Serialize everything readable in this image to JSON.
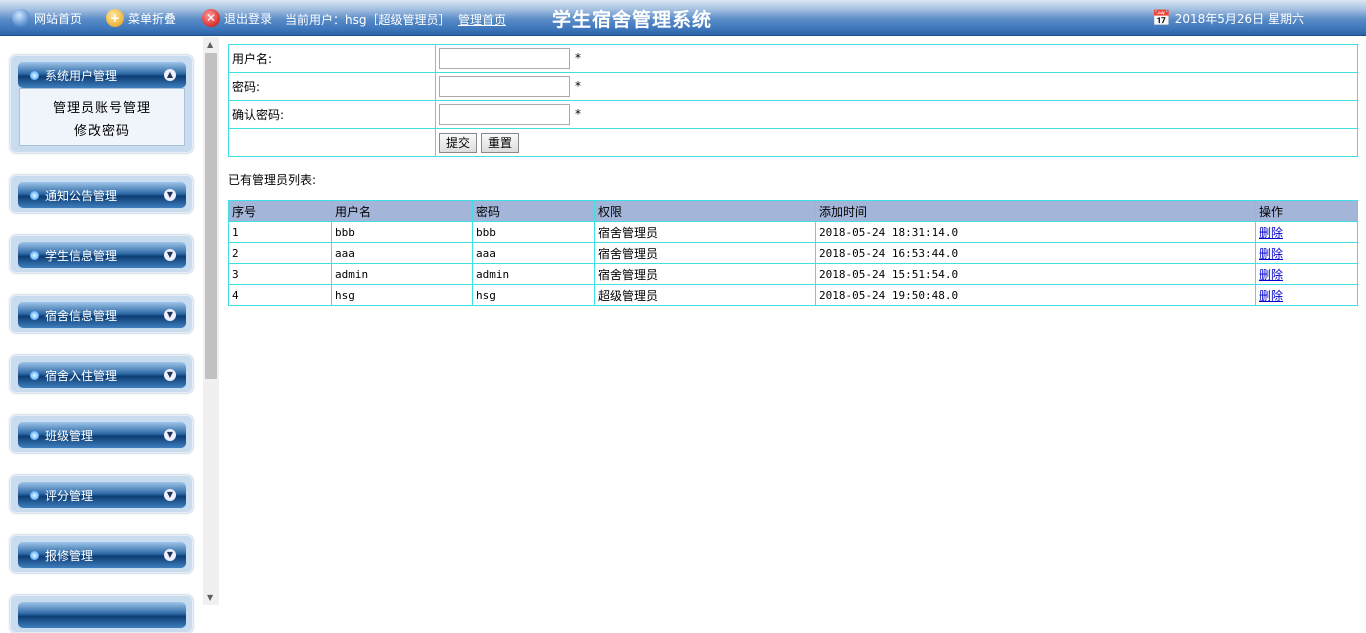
{
  "header": {
    "home": "网站首页",
    "fold": "菜单折叠",
    "logout": "退出登录",
    "current_user": "当前用户：hsg［超级管理员］",
    "admin_home": "管理首页",
    "title": "学生宿舍管理系统",
    "date": "2018年5月26日 星期六"
  },
  "sidebar": {
    "groups": [
      {
        "label": "系统用户管理",
        "items": [
          "管理员账号管理",
          "修改密码"
        ]
      },
      {
        "label": "通知公告管理"
      },
      {
        "label": "学生信息管理"
      },
      {
        "label": "宿舍信息管理"
      },
      {
        "label": "宿舍入住管理"
      },
      {
        "label": "班级管理"
      },
      {
        "label": "评分管理"
      },
      {
        "label": "报修管理"
      }
    ]
  },
  "form": {
    "username_label": "用户名:",
    "password_label": "密码:",
    "confirm_label": "确认密码:",
    "required": "*",
    "submit": "提交",
    "reset": "重置"
  },
  "list": {
    "title": "已有管理员列表:",
    "headers": [
      "序号",
      "用户名",
      "密码",
      "权限",
      "添加时间",
      "操作"
    ],
    "rows": [
      {
        "no": "1",
        "user": "bbb",
        "pwd": "bbb",
        "role": "宿舍管理员",
        "time": "2018-05-24 18:31:14.0",
        "op": "删除"
      },
      {
        "no": "2",
        "user": "aaa",
        "pwd": "aaa",
        "role": "宿舍管理员",
        "time": "2018-05-24 16:53:44.0",
        "op": "删除"
      },
      {
        "no": "3",
        "user": "admin",
        "pwd": "admin",
        "role": "宿舍管理员",
        "time": "2018-05-24 15:51:54.0",
        "op": "删除"
      },
      {
        "no": "4",
        "user": "hsg",
        "pwd": "hsg",
        "role": "超级管理员",
        "time": "2018-05-24 19:50:48.0",
        "op": "删除"
      }
    ]
  }
}
